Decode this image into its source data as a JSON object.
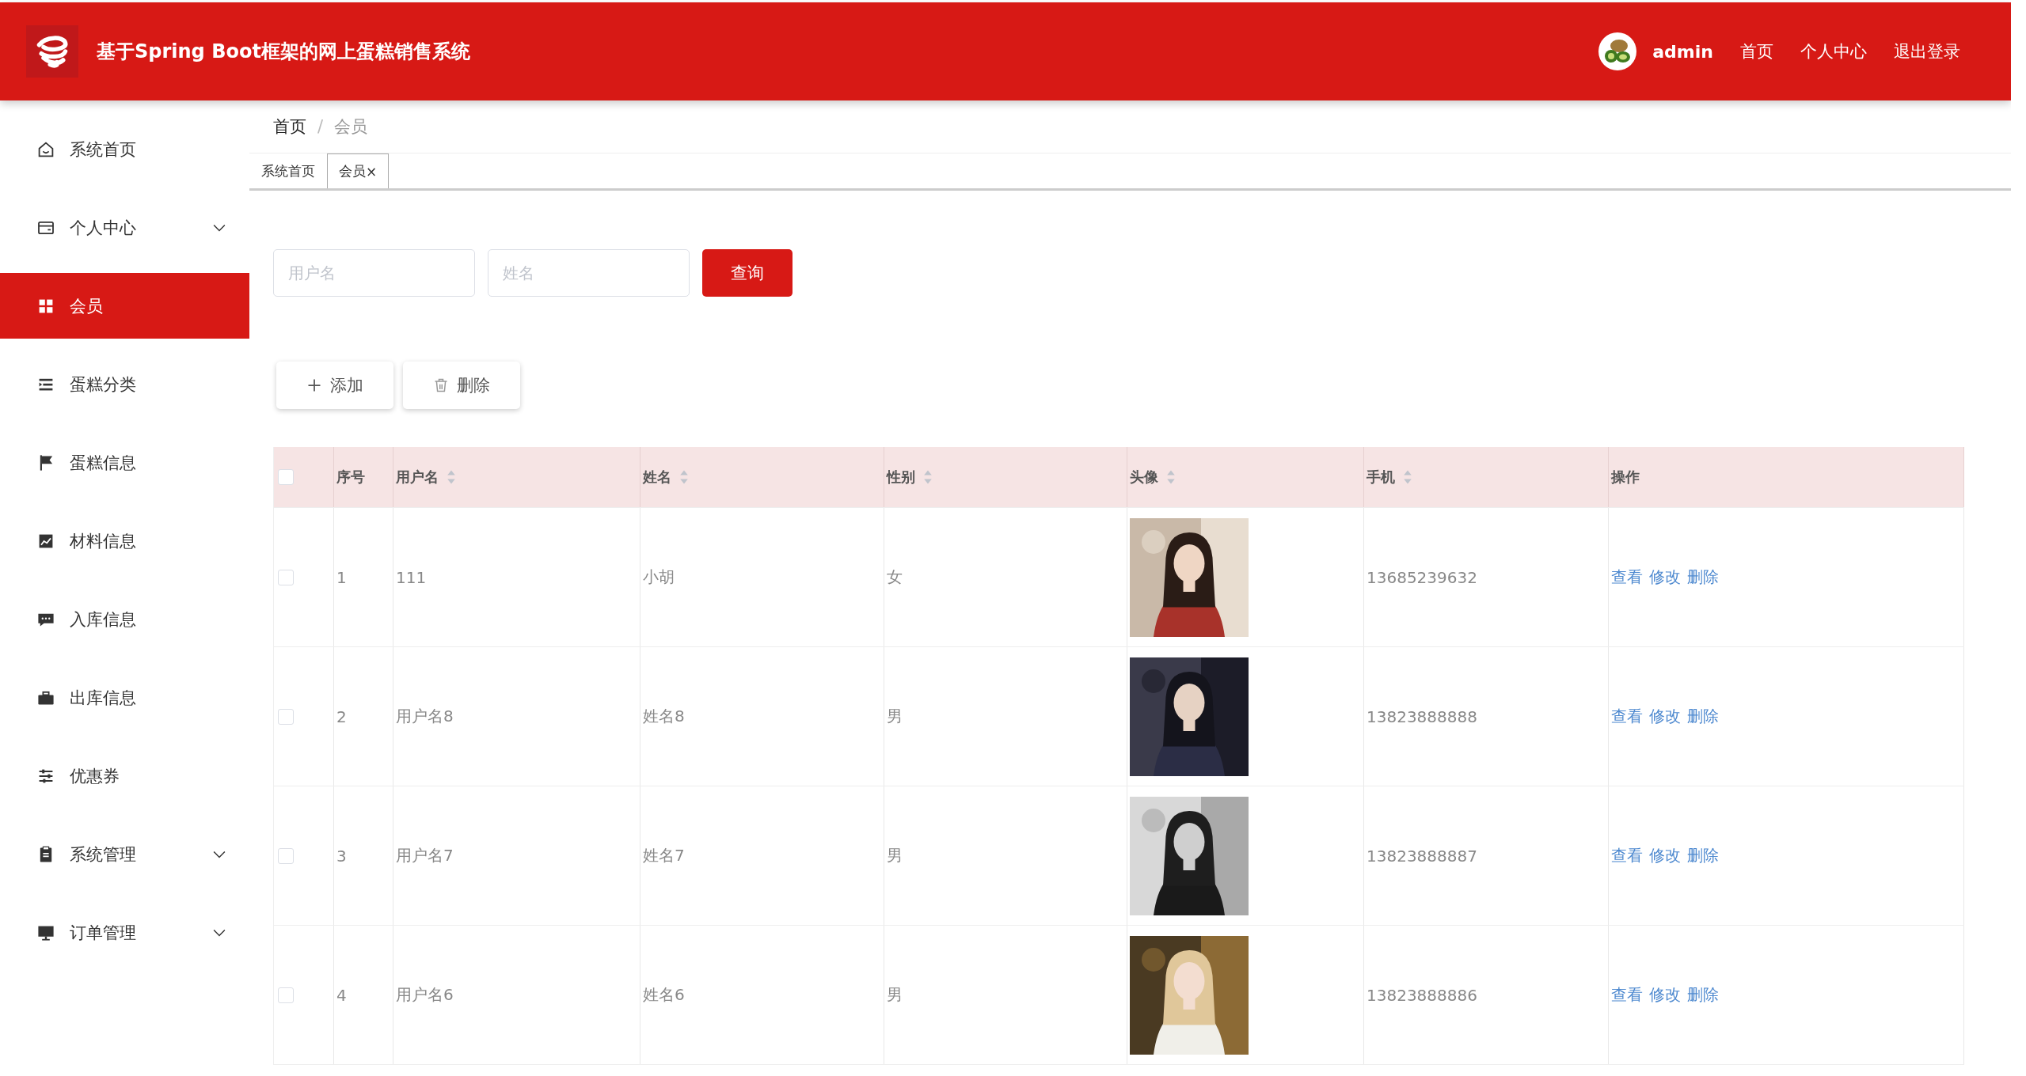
{
  "header": {
    "title": "基于Spring Boot框架的网上蛋糕销售系统",
    "user": "admin",
    "links": [
      "首页",
      "个人中心",
      "退出登录"
    ]
  },
  "sidebar": {
    "items": [
      {
        "label": "系统首页",
        "selected": false,
        "expandable": false
      },
      {
        "label": "个人中心",
        "selected": false,
        "expandable": true
      },
      {
        "label": "会员",
        "selected": true,
        "expandable": false
      },
      {
        "label": "蛋糕分类",
        "selected": false,
        "expandable": false
      },
      {
        "label": "蛋糕信息",
        "selected": false,
        "expandable": false
      },
      {
        "label": "材料信息",
        "selected": false,
        "expandable": false
      },
      {
        "label": "入库信息",
        "selected": false,
        "expandable": false
      },
      {
        "label": "出库信息",
        "selected": false,
        "expandable": false
      },
      {
        "label": "优惠券",
        "selected": false,
        "expandable": false
      },
      {
        "label": "系统管理",
        "selected": false,
        "expandable": true
      },
      {
        "label": "订单管理",
        "selected": false,
        "expandable": true
      }
    ]
  },
  "breadcrumb": [
    "首页",
    "会员"
  ],
  "breadcrumb_separator": "/",
  "tabs": [
    {
      "label": "系统首页",
      "selected": false,
      "closable": false
    },
    {
      "label": "会员",
      "selected": true,
      "closable": true
    }
  ],
  "tab_close": "×",
  "search": {
    "fields": [
      {
        "placeholder": "用户名"
      },
      {
        "placeholder": "姓名"
      }
    ],
    "button": "查询"
  },
  "actions": [
    {
      "label": "添加",
      "kind": "add"
    },
    {
      "label": "删除",
      "kind": "delete"
    }
  ],
  "table": {
    "columns": [
      {
        "label": "序号",
        "sortable": false
      },
      {
        "label": "用户名",
        "sortable": true
      },
      {
        "label": "姓名",
        "sortable": true
      },
      {
        "label": "性别",
        "sortable": true
      },
      {
        "label": "头像",
        "sortable": true
      },
      {
        "label": "手机",
        "sortable": true
      },
      {
        "label": "操作",
        "sortable": false
      }
    ],
    "all_checked": false,
    "rows": [
      {
        "checked": false,
        "index": "1",
        "username": "111",
        "name": "小胡",
        "gender": "女",
        "avatar": {
          "kind": "picture"
        },
        "phone": "13685239632",
        "actions": [
          "查看",
          "修改",
          "删除"
        ]
      },
      {
        "checked": false,
        "index": "2",
        "username": "用户名8",
        "name": "姓名8",
        "gender": "男",
        "avatar": {
          "kind": "picture"
        },
        "phone": "13823888888",
        "actions": [
          "查看",
          "修改",
          "删除"
        ]
      },
      {
        "checked": false,
        "index": "3",
        "username": "用户名7",
        "name": "姓名7",
        "gender": "男",
        "avatar": {
          "kind": "picture"
        },
        "phone": "13823888887",
        "actions": [
          "查看",
          "修改",
          "删除"
        ]
      },
      {
        "checked": false,
        "index": "4",
        "username": "用户名6",
        "name": "姓名6",
        "gender": "男",
        "avatar": {
          "kind": "picture"
        },
        "phone": "13823888886",
        "actions": [
          "查看",
          "修改",
          "删除"
        ]
      }
    ]
  }
}
